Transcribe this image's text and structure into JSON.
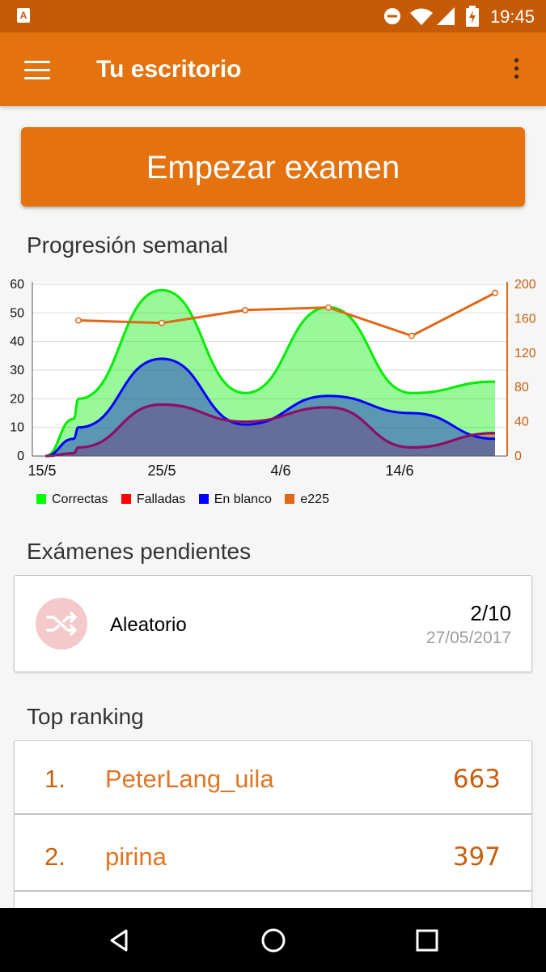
{
  "status_bar": {
    "time": "19:45",
    "icons": [
      "notification-a-icon",
      "do-not-disturb-icon",
      "wifi-icon",
      "signal-icon",
      "battery-charging-icon"
    ]
  },
  "app_bar": {
    "title": "Tu escritorio",
    "menu_icon": "menu-icon",
    "overflow_icon": "more-vert-icon"
  },
  "start_button": {
    "label": "Empezar examen"
  },
  "weekly": {
    "title": "Progresión semanal",
    "legend": [
      {
        "label": "Correctas",
        "color": "#00ff00"
      },
      {
        "label": "Falladas",
        "color": "#ff0000"
      },
      {
        "label": "En blanco",
        "color": "#0000ff"
      },
      {
        "label": "e225",
        "color": "#e06818"
      }
    ]
  },
  "chart_data": {
    "type": "area",
    "x_tick_labels": [
      "15/5",
      "25/5",
      "4/6",
      "14/6"
    ],
    "x": [
      "15/5",
      "16/5",
      "19/5",
      "25/5",
      "1/6",
      "7/6",
      "14/6",
      "22/6"
    ],
    "ylim_left": [
      0,
      60
    ],
    "yticks_left": [
      0,
      10,
      20,
      30,
      40,
      50,
      60
    ],
    "ylim_right": [
      0,
      200
    ],
    "yticks_right": [
      0,
      40,
      80,
      120,
      160,
      200
    ],
    "grid": true,
    "legend_position": "bottom-left",
    "series": [
      {
        "name": "Correctas",
        "axis": "left",
        "color": "#00ff00",
        "values": [
          0,
          13,
          20,
          58,
          22,
          52,
          22,
          26
        ]
      },
      {
        "name": "Falladas",
        "axis": "left",
        "color": "#ff0000",
        "values": [
          0,
          1,
          3,
          18,
          12,
          17,
          3,
          8
        ]
      },
      {
        "name": "En blanco",
        "axis": "left",
        "color": "#0000ff",
        "values": [
          0,
          6,
          10,
          34,
          11,
          21,
          15,
          6
        ]
      },
      {
        "name": "e225",
        "axis": "right",
        "color": "#e06818",
        "x": [
          "19/5",
          "25/5",
          "1/6",
          "7/6",
          "14/6",
          "22/6"
        ],
        "values": [
          158,
          155,
          170,
          173,
          140,
          190
        ]
      }
    ]
  },
  "pending": {
    "title": "Exámenes pendientes",
    "exam": {
      "name": "Aleatorio",
      "progress": "2/10",
      "date": "27/05/2017",
      "icon": "shuffle-icon"
    }
  },
  "ranking": {
    "title": "Top ranking",
    "rows": [
      {
        "pos": "1.",
        "name": "PeterLang_uila",
        "score": "663"
      },
      {
        "pos": "2.",
        "name": "pirina",
        "score": "397"
      }
    ]
  },
  "nav_bar": {
    "icons": [
      "back-icon",
      "home-icon",
      "recents-icon"
    ]
  }
}
